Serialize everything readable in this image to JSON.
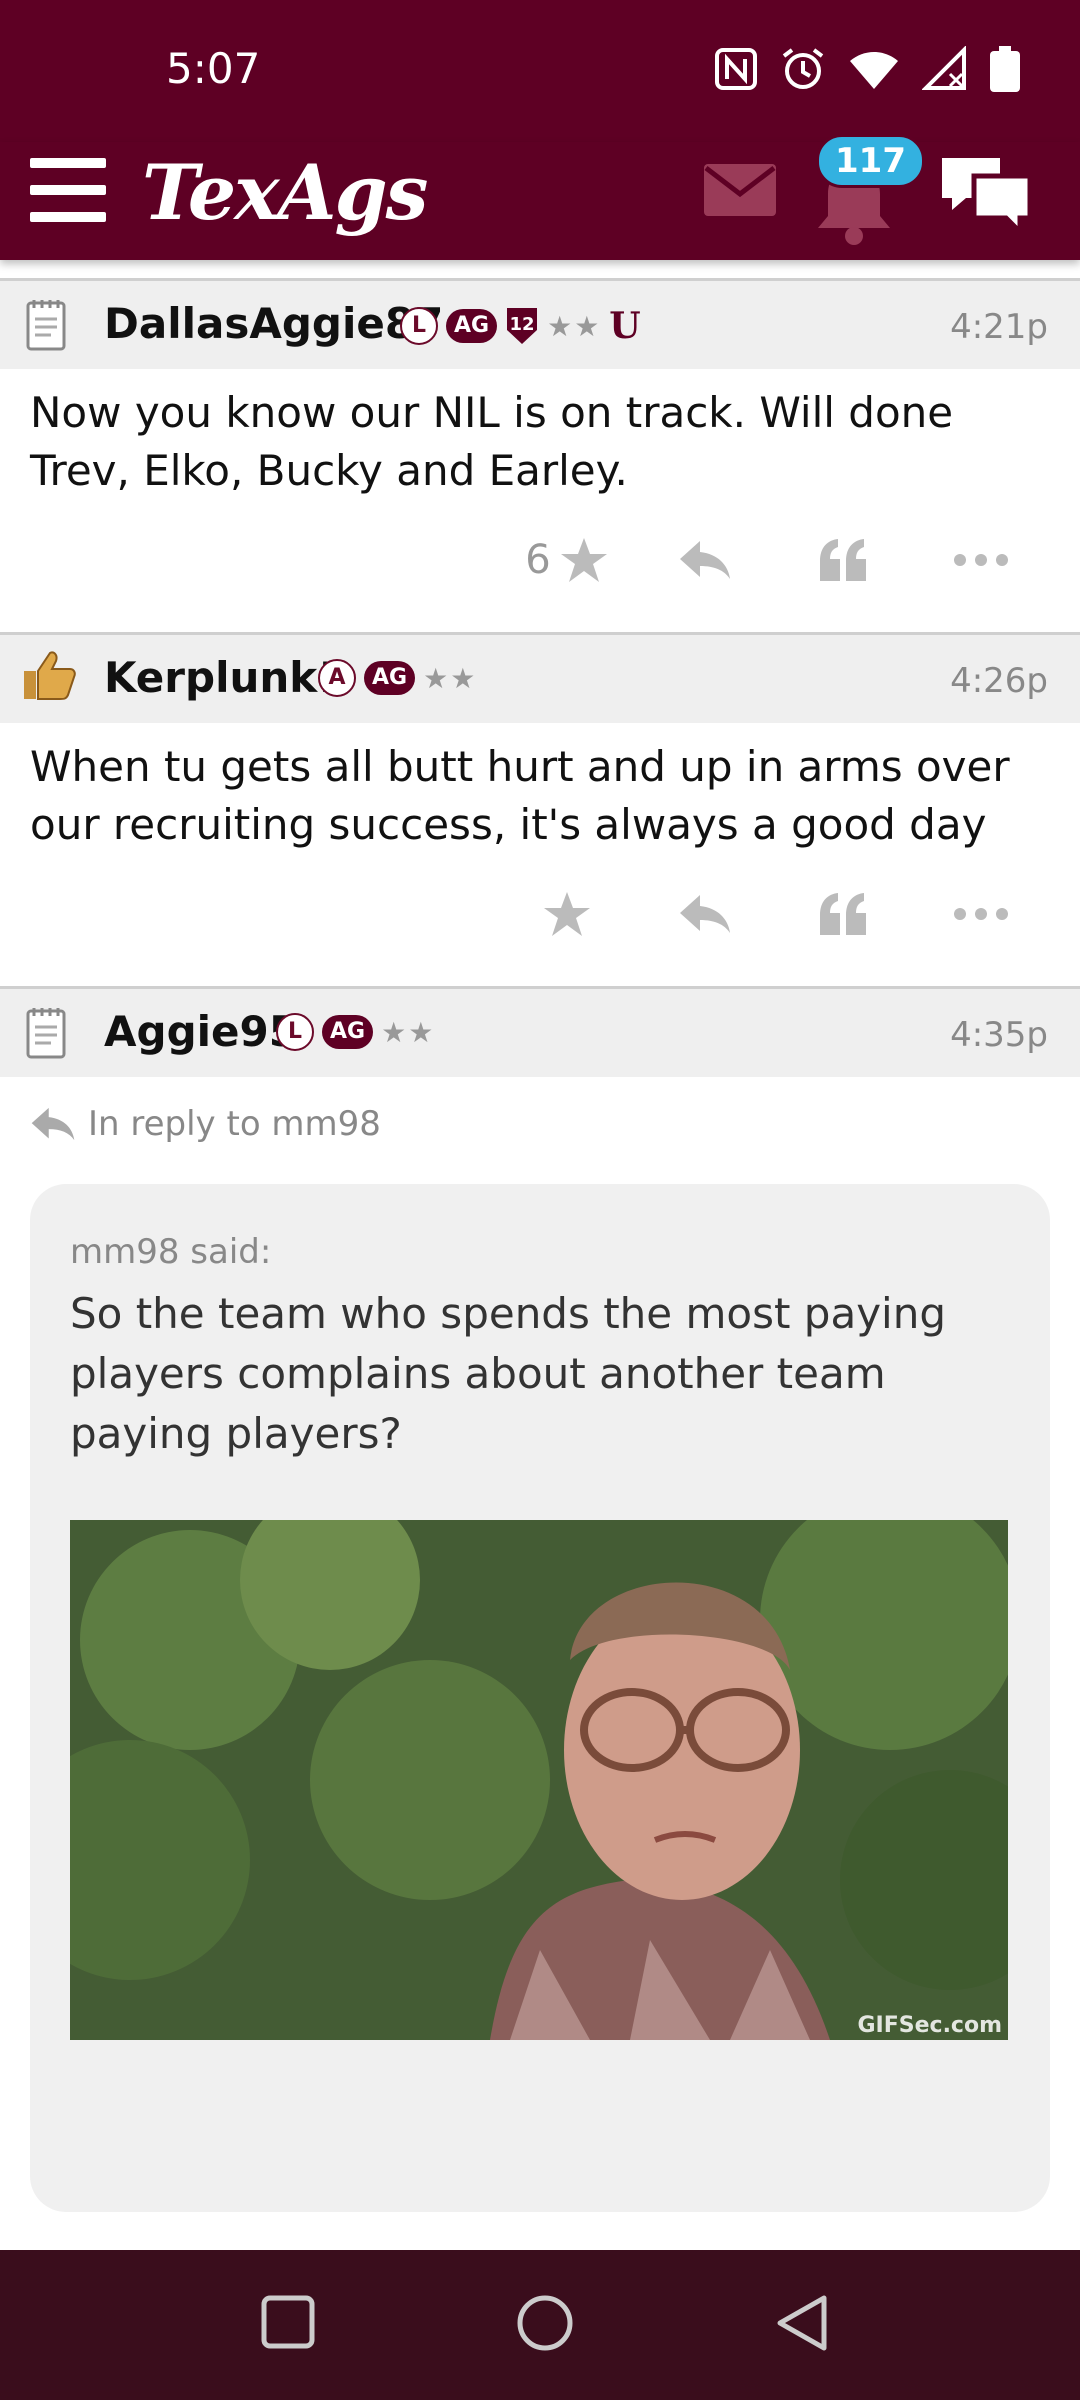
{
  "status_bar": {
    "time": "5:07"
  },
  "app": {
    "logo": "TexAgs",
    "notification_count": "117"
  },
  "posts": [
    {
      "username": "DallasAggie87",
      "badges": [
        "L",
        "AG",
        "12",
        "★★",
        "U"
      ],
      "time": "4:21p",
      "body": "Now you know our NIL is on track. Will done Trev, Elko, Bucky and Earley.",
      "star_count": "6"
    },
    {
      "username": "Kerplunk!",
      "badges": [
        "A",
        "AG",
        "★★"
      ],
      "time": "4:26p",
      "body": "When tu gets all butt hurt and up in arms over our recruiting success, it's always a good day"
    },
    {
      "username": "Aggie95",
      "badges": [
        "L",
        "AG",
        "★★"
      ],
      "time": "4:35p",
      "reply_to": "In reply to mm98",
      "quote": {
        "author": "mm98 said:",
        "text": "So the team who spends the most paying players complains about another team paying players?",
        "gif_credit": "GIFSec.com"
      }
    }
  ],
  "colors": {
    "maroon": "#5e0024",
    "badge_blue": "#33b1e0"
  }
}
